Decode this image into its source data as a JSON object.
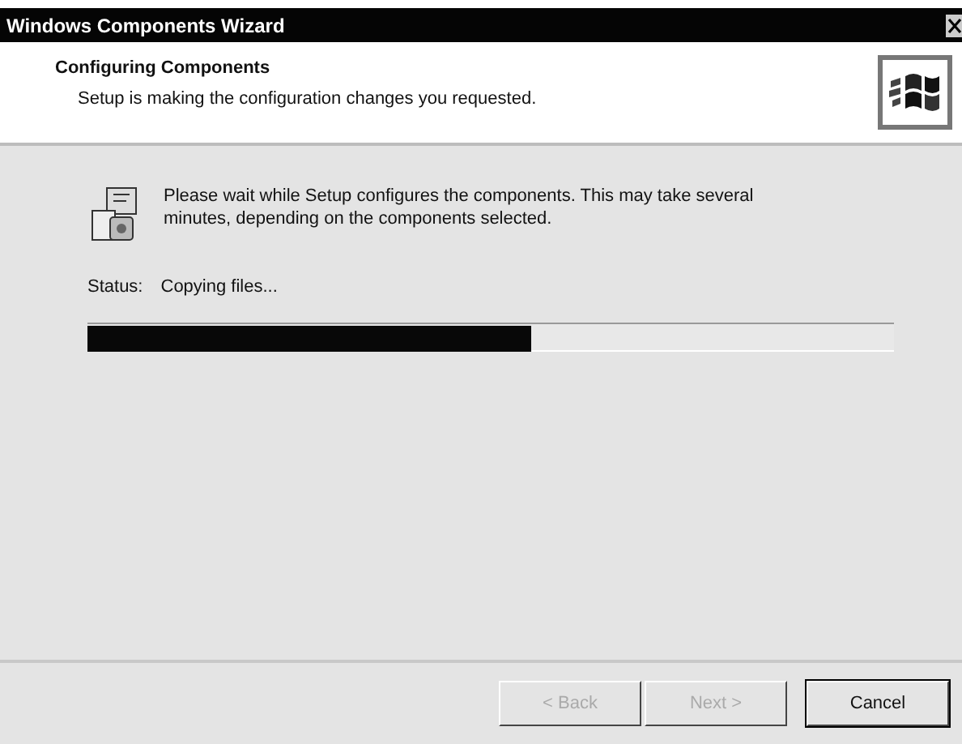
{
  "window": {
    "title": "Windows Components Wizard"
  },
  "header": {
    "title": "Configuring Components",
    "subtitle": "Setup is making the configuration changes you requested."
  },
  "message": "Please wait while Setup configures the components. This may take several minutes, depending on the components selected.",
  "status": {
    "label": "Status:",
    "value": "Copying files..."
  },
  "progress": {
    "level": 0.55
  },
  "buttons": [
    {
      "label": "< Back",
      "disabled": true,
      "default": false
    },
    {
      "label": "Next >",
      "disabled": true,
      "default": false
    },
    {
      "label": "Cancel",
      "disabled": false,
      "default": true
    }
  ]
}
